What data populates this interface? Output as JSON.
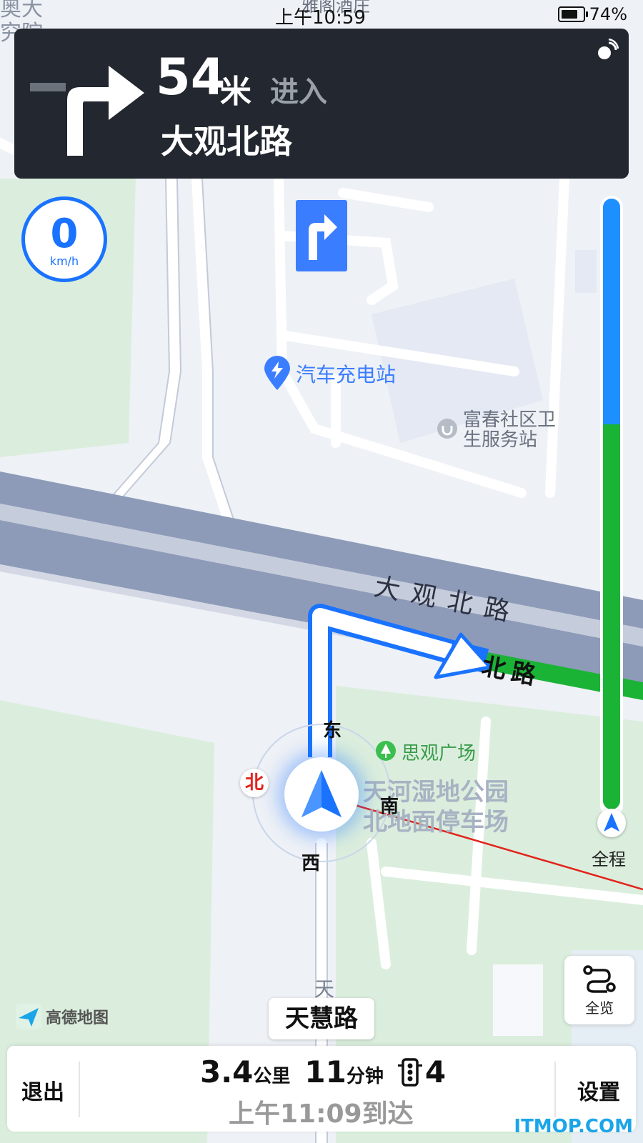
{
  "status_bar": {
    "time": "上午10:59",
    "battery": "74%"
  },
  "guidance": {
    "distance": "54",
    "unit": "米",
    "action": "进入",
    "road": "大观北路",
    "maneuver_icon": "turn-right-icon"
  },
  "speedometer": {
    "value": "0",
    "unit": "km/h"
  },
  "map_labels": {
    "poi_charging": "汽车充电站",
    "poi_clinic_line1": "富春社区卫",
    "poi_clinic_line2": "生服务站",
    "road_main": "大观北路",
    "road_route": "北路",
    "poi_square": "思观广场",
    "park_line1": "天河湿地公园",
    "park_line2": "北地面停车场",
    "top_left_1": "奥大",
    "top_left_2": "究院",
    "top_poi": "雅阁酒庄",
    "road_bottom_1": "天",
    "road_bottom_2": "慧"
  },
  "compass": {
    "north": "北",
    "east": "东",
    "south": "南",
    "west": "西"
  },
  "progress": {
    "label": "全程",
    "traveled_fraction": 0.37
  },
  "overview_button": {
    "label": "全览"
  },
  "current_road": "天慧路",
  "logo": "高德地图",
  "bottom_bar": {
    "exit": "退出",
    "settings": "设置",
    "distance": "3.4",
    "distance_unit": "公里",
    "time": "11",
    "time_unit": "分钟",
    "lights": "4",
    "arrival": "上午11:09到达"
  },
  "watermark": "ITMOP.COM",
  "colors": {
    "route": "#1a73ff",
    "traffic_clear": "#1bb336",
    "panel": "#23272f"
  }
}
